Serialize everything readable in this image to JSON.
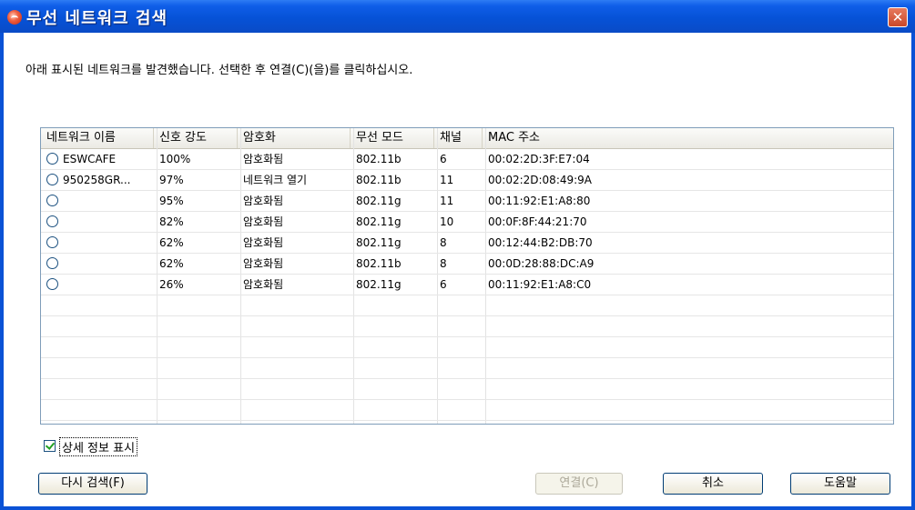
{
  "window": {
    "title": "무선 네트워크 검색",
    "close_glyph": "✕"
  },
  "instruction": "아래 표시된 네트워크를 발견했습니다. 선택한 후 연결(C)(을)를 클릭하십시오.",
  "table": {
    "columns": [
      "네트워크 이름",
      "신호 강도",
      "암호화",
      "무선 모드",
      "채널",
      "MAC 주소"
    ],
    "rows": [
      [
        "ESWCAFE",
        "100%",
        "암호화됨",
        "802.11b",
        "6",
        "00:02:2D:3F:E7:04"
      ],
      [
        "950258GR...",
        "97%",
        "네트워크 열기",
        "802.11b",
        "11",
        "00:02:2D:08:49:9A"
      ],
      [
        "",
        "95%",
        "암호화됨",
        "802.11g",
        "11",
        "00:11:92:E1:A8:80"
      ],
      [
        "",
        "82%",
        "암호화됨",
        "802.11g",
        "10",
        "00:0F:8F:44:21:70"
      ],
      [
        "",
        "62%",
        "암호화됨",
        "802.11g",
        "8",
        "00:12:44:B2:DB:70"
      ],
      [
        "",
        "62%",
        "암호화됨",
        "802.11b",
        "8",
        "00:0D:28:88:DC:A9"
      ],
      [
        "",
        "26%",
        "암호화됨",
        "802.11g",
        "6",
        "00:11:92:E1:A8:C0"
      ]
    ]
  },
  "show_details": {
    "label": "상세 정보 표시",
    "checked": true
  },
  "buttons": {
    "rescan": "다시 검색(F)",
    "connect": "연결(C)",
    "cancel": "취소",
    "help": "도움말"
  }
}
